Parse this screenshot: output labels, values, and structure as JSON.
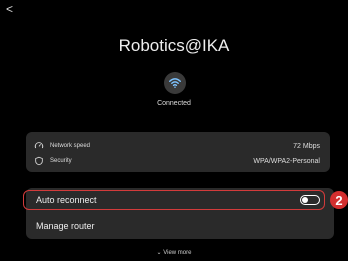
{
  "nav": {
    "back_glyph": "<"
  },
  "network": {
    "name": "Robotics@IKA",
    "status": "Connected",
    "icon": "wifi-icon"
  },
  "info": [
    {
      "label": "Network speed",
      "value": "72 Mbps",
      "icon": "speed-gauge-icon"
    },
    {
      "label": "Security",
      "value": "WPA/WPA2-Personal",
      "icon": "shield-icon"
    }
  ],
  "settings": {
    "auto_reconnect": {
      "label": "Auto reconnect",
      "enabled": false
    },
    "manage_router": {
      "label": "Manage router"
    }
  },
  "annotation": {
    "badge_number": "2",
    "color": "#d32f2f"
  },
  "footer": {
    "view_more": "View more",
    "chevron": "⌄"
  }
}
